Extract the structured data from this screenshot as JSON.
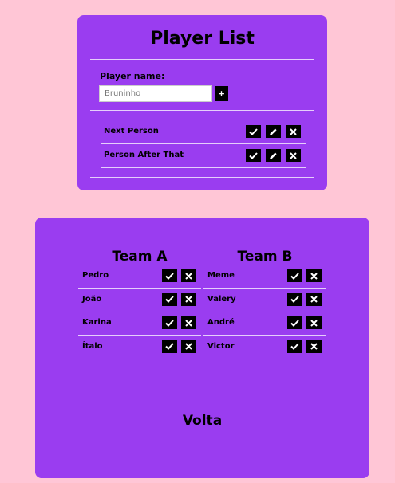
{
  "player_list": {
    "title": "Player List",
    "input_label": "Player name:",
    "input_placeholder": "Bruninho",
    "add_button_label": "+",
    "players": [
      {
        "name": "Next Person"
      },
      {
        "name": "Person After That"
      }
    ]
  },
  "teams": {
    "team_a": {
      "title": "Team A",
      "members": [
        "Pedro",
        "João",
        "Karina",
        "Ítalo"
      ]
    },
    "team_b": {
      "title": "Team B",
      "members": [
        "Meme",
        "Valery",
        "André",
        "Victor"
      ]
    },
    "footer_label": "Volta"
  },
  "colors": {
    "background": "#ffc6d6",
    "card": "#9a3df0",
    "button": "#000000"
  },
  "icons": {
    "confirm": "check-icon",
    "edit": "pencil-icon",
    "remove": "close-icon"
  }
}
